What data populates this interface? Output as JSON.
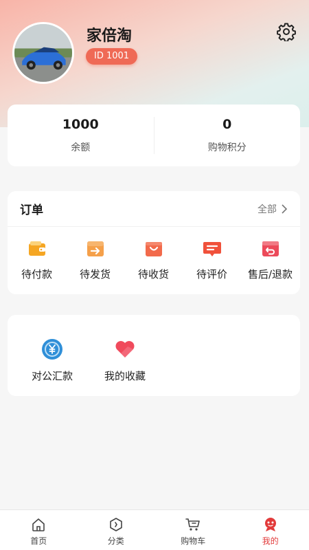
{
  "profile": {
    "name": "家倍淘",
    "id_badge": "ID 1001"
  },
  "stats": [
    {
      "value": "1000",
      "label": "余额"
    },
    {
      "value": "0",
      "label": "购物积分"
    }
  ],
  "orders": {
    "title": "订单",
    "all_label": "全部",
    "items": [
      {
        "label": "待付款",
        "icon": "wallet-icon"
      },
      {
        "label": "待发货",
        "icon": "ship-box-icon"
      },
      {
        "label": "待收货",
        "icon": "receive-bag-icon"
      },
      {
        "label": "待评价",
        "icon": "review-icon"
      },
      {
        "label": "售后/退款",
        "icon": "refund-icon"
      }
    ]
  },
  "services": [
    {
      "label": "对公汇款",
      "icon": "yuan-transfer-icon"
    },
    {
      "label": "我的收藏",
      "icon": "heart-icon"
    }
  ],
  "tabbar": {
    "items": [
      {
        "label": "首页",
        "icon": "home-icon"
      },
      {
        "label": "分类",
        "icon": "category-icon"
      },
      {
        "label": "购物车",
        "icon": "cart-icon"
      },
      {
        "label": "我的",
        "icon": "profile-icon",
        "active": true
      }
    ]
  },
  "colors": {
    "accent": "#ef6a56",
    "active_tab": "#e23b3b",
    "icon_orange": "#f5a623",
    "icon_red": "#f0513b"
  }
}
